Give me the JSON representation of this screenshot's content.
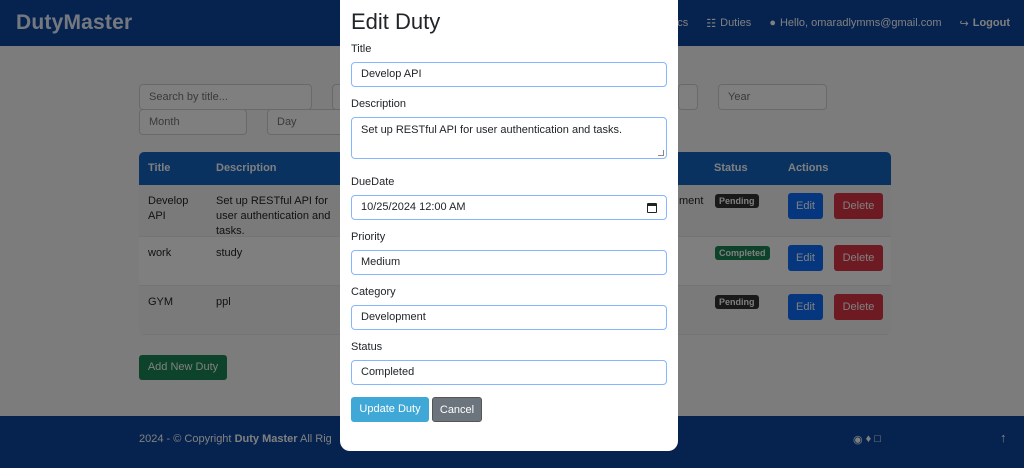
{
  "navbar": {
    "brand": "DutyMaster",
    "links": [
      {
        "label": "ics"
      },
      {
        "label": "Duties"
      },
      {
        "label": "Hello, omaradlymms@gmail.com"
      },
      {
        "label": "Logout"
      }
    ]
  },
  "filters": {
    "search_placeholder": "Search by title...",
    "year_placeholder": "Year",
    "month_placeholder": "Month",
    "day_placeholder": "Day"
  },
  "table": {
    "headers": [
      "Title",
      "Description",
      "Status",
      "Actions"
    ],
    "rows": [
      {
        "title": "Develop API",
        "description": "Set up RESTful API for user authentication and tasks.",
        "category": "ment",
        "status": "Pending",
        "edit": "Edit",
        "delete": "Delete"
      },
      {
        "title": "work",
        "description": "study",
        "status": "Completed",
        "edit": "Edit",
        "delete": "Delete"
      },
      {
        "title": "GYM",
        "description": "ppl",
        "status": "Pending",
        "edit": "Edit",
        "delete": "Delete"
      }
    ]
  },
  "add_button": "Add New Duty",
  "footer": {
    "prefix": "2024 - © Copyright",
    "brand": "Duty Master",
    "suffix": "All Rig"
  },
  "modal": {
    "title": "Edit Duty",
    "fields": {
      "title": {
        "label": "Title",
        "value": "Develop API"
      },
      "description": {
        "label": "Description",
        "value": "Set up RESTful API for user authentication and tasks."
      },
      "due_date": {
        "label": "DueDate",
        "value": "10/25/2024 12:00  AM"
      },
      "priority": {
        "label": "Priority",
        "value": "Medium"
      },
      "category": {
        "label": "Category",
        "value": "Development"
      },
      "status": {
        "label": "Status",
        "value": "Completed"
      }
    },
    "update_label": "Update Duty",
    "cancel_label": "Cancel"
  }
}
